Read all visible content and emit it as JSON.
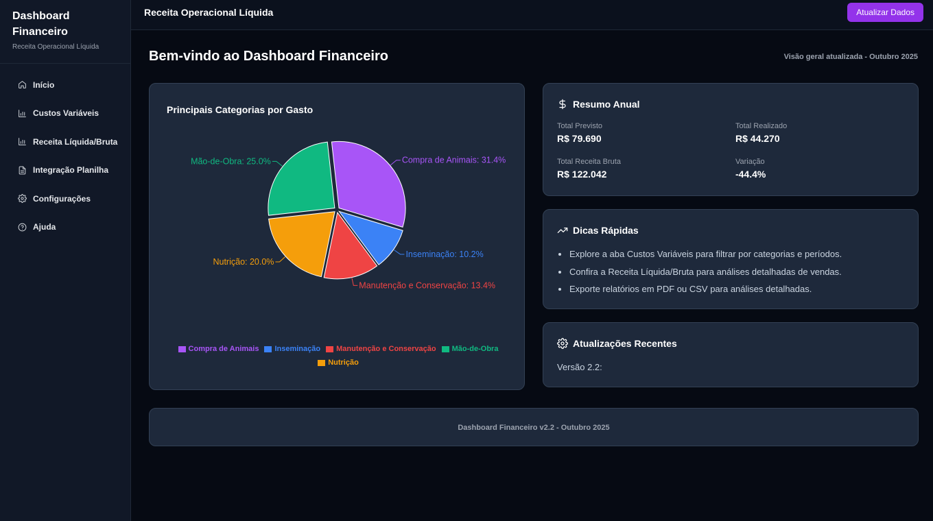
{
  "brand": {
    "title": "Dashboard Financeiro",
    "subtitle": "Receita Operacional Líquida"
  },
  "sidebar": {
    "items": [
      {
        "label": "Início",
        "icon": "home-icon"
      },
      {
        "label": "Custos Variáveis",
        "icon": "bar-chart-icon"
      },
      {
        "label": "Receita Líquida/Bruta",
        "icon": "bar-chart-icon"
      },
      {
        "label": "Integração Planilha",
        "icon": "file-spreadsheet-icon"
      },
      {
        "label": "Configurações",
        "icon": "gear-icon"
      },
      {
        "label": "Ajuda",
        "icon": "help-circle-icon"
      }
    ]
  },
  "topbar": {
    "title": "Receita Operacional Líquida",
    "update_button": "Atualizar Dados"
  },
  "main": {
    "title": "Bem-vindo ao Dashboard Financeiro",
    "subtitle": "Visão geral atualizada - Outubro 2025"
  },
  "chart_card": {
    "title": "Principais Categorias por Gasto"
  },
  "chart_data": {
    "type": "pie",
    "title": "Principais Categorias por Gasto",
    "slices": [
      {
        "label": "Compra de Animais",
        "value": 31.4,
        "color": "#a855f7"
      },
      {
        "label": "Inseminação",
        "value": 10.2,
        "color": "#3b82f6"
      },
      {
        "label": "Manutenção e Conservação",
        "value": 13.4,
        "color": "#ef4444"
      },
      {
        "label": "Nutrição",
        "value": 20.0,
        "color": "#f59e0b"
      },
      {
        "label": "Mão-de-Obra",
        "value": 25.0,
        "color": "#10b981"
      }
    ],
    "legend_order": [
      "Compra de Animais",
      "Inseminação",
      "Manutenção e Conservação",
      "Mão-de-Obra",
      "Nutrição"
    ],
    "legend_position": "bottom"
  },
  "summary": {
    "title": "Resumo Anual",
    "items": [
      {
        "label": "Total Previsto",
        "value": "R$ 79.690"
      },
      {
        "label": "Total Realizado",
        "value": "R$ 44.270"
      },
      {
        "label": "Total Receita Bruta",
        "value": "R$ 122.042"
      },
      {
        "label": "Variação",
        "value": "-44.4%"
      }
    ]
  },
  "tips": {
    "title": "Dicas Rápidas",
    "items": [
      "Explore a aba Custos Variáveis para filtrar por categorias e períodos.",
      "Confira a Receita Líquida/Bruta para análises detalhadas de vendas.",
      "Exporte relatórios em PDF ou CSV para análises detalhadas."
    ]
  },
  "updates": {
    "title": "Atualizações Recentes",
    "version": "Versão 2.2:"
  },
  "footer": {
    "text": "Dashboard Financeiro v2.2 - Outubro 2025"
  }
}
